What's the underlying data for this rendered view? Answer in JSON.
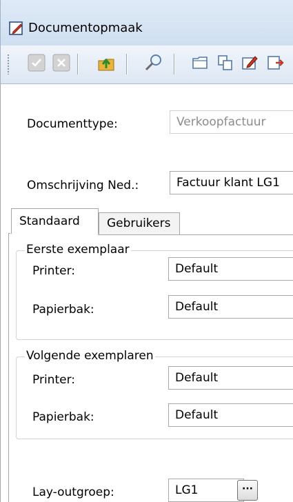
{
  "window": {
    "title": "Documentopmaak"
  },
  "toolbar": {
    "buttons": [
      "checkmark-icon",
      "cancel-icon",
      "upload-folder-icon",
      "search-icon",
      "open-folder-icon",
      "copy-icon",
      "edit-icon",
      "export-icon"
    ]
  },
  "form": {
    "documenttype_label": "Documenttype:",
    "documenttype_value": "Verkoopfactuur",
    "omschrijving_label": "Omschrijving Ned.:",
    "omschrijving_value": "Factuur klant LG1"
  },
  "tabs": [
    {
      "label": "Standaard",
      "active": true
    },
    {
      "label": "Gebruikers",
      "active": false
    }
  ],
  "eerste_exemplaar": {
    "title": "Eerste exemplaar",
    "printer_label": "Printer:",
    "printer_value": "Default",
    "papierbak_label": "Papierbak:",
    "papierbak_value": "Default"
  },
  "volgende_exemplaren": {
    "title": "Volgende exemplaren",
    "printer_label": "Printer:",
    "printer_value": "Default",
    "papierbak_label": "Papierbak:",
    "papierbak_value": "Default"
  },
  "layout_group": {
    "label": "Lay-outgroep:",
    "value": "LG1",
    "browse_label": "···"
  }
}
